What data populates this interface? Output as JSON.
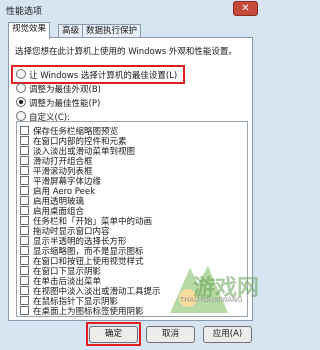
{
  "window": {
    "title": "性能选项",
    "close_symbol": "✕"
  },
  "tabs": [
    "视觉效果",
    "高级",
    "数据执行保护"
  ],
  "description": "选择您想在此计算机上使用的 Windows 外观和性能设置。",
  "radios": [
    {
      "label": "让 Windows 选择计算机的最佳设置(L)",
      "selected": false
    },
    {
      "label": "调整为最佳外观(B)",
      "selected": false
    },
    {
      "label": "调整为最佳性能(P)",
      "selected": true
    },
    {
      "label": "自定义(C):",
      "selected": false
    }
  ],
  "options": [
    "保存任务栏缩略图预览",
    "在窗口内部的控件和元素",
    "淡入淡出或滑动菜单到视图",
    "滑动打开组合框",
    "平滑滚动列表框",
    "平滑屏幕字体边缘",
    "启用 Aero Peek",
    "启用透明玻璃",
    "启用桌面组合",
    "任务栏和「开始」菜单中的动画",
    "拖动时显示窗口内容",
    "显示半透明的选择长方形",
    "显示缩略图，而不是显示图标",
    "在窗口和按钮上使用视觉样式",
    "在窗口下显示阴影",
    "在单击后淡出菜单",
    "在视图中淡入淡出或滑动工具提示",
    "在鼠标指针下显示阴影",
    "在桌面上为图标标签使用阴影"
  ],
  "buttons": {
    "ok": "确定",
    "cancel": "取消",
    "apply": "应用(A)"
  },
  "watermark": {
    "text": "游戏网",
    "sub": "THAOYOUXIWANG"
  }
}
